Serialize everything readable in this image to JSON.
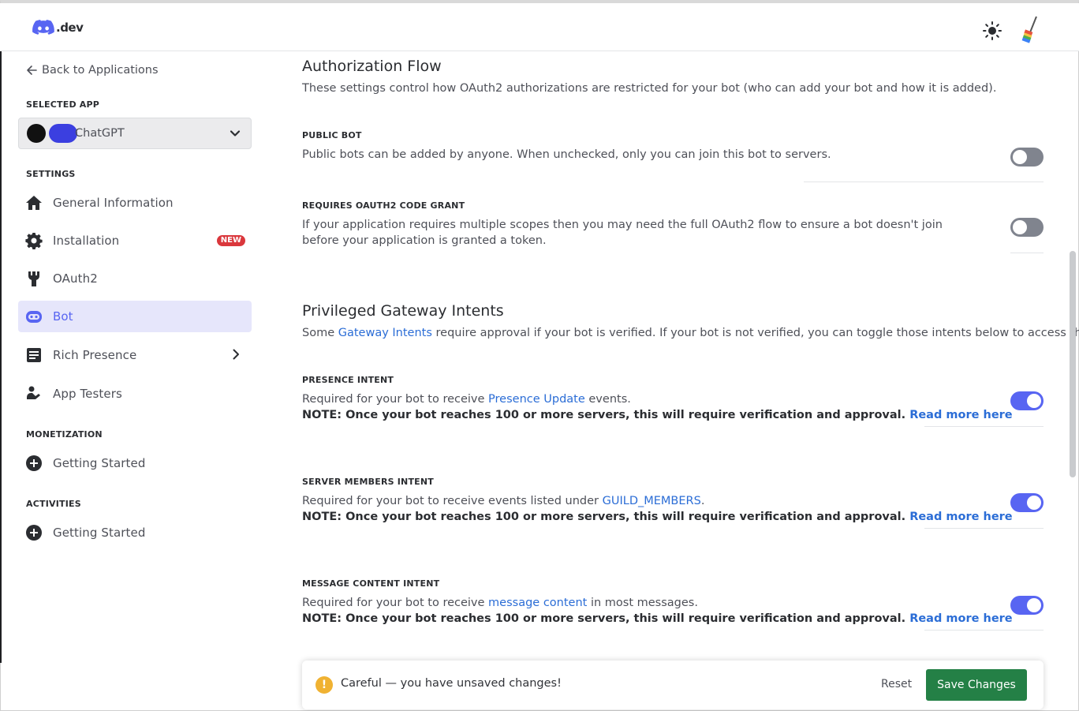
{
  "header": {
    "logo_text": ".dev",
    "theme_icon": "sun-icon",
    "user_icon": "avatar-icon"
  },
  "sidebar": {
    "back_label": "Back to Applications",
    "selected_app_label": "SELECTED APP",
    "app_name": "ChatGPT",
    "settings_label": "SETTINGS",
    "items": [
      {
        "label": "General Information",
        "icon": "home-icon"
      },
      {
        "label": "Installation",
        "icon": "gear-icon",
        "badge": "NEW"
      },
      {
        "label": "OAuth2",
        "icon": "wrench-icon"
      },
      {
        "label": "Bot",
        "icon": "robot-icon",
        "active": true
      },
      {
        "label": "Rich Presence",
        "icon": "document-icon"
      },
      {
        "label": "App Testers",
        "icon": "user-icon"
      }
    ],
    "monetization_label": "MONETIZATION",
    "monetization_item": "Getting Started",
    "activities_label": "ACTIVITIES",
    "activities_item": "Getting Started"
  },
  "main": {
    "auth_title": "Authorization Flow",
    "auth_desc": "These settings control how OAuth2 authorizations are restricted for your bot (who can add your bot and how it is added).",
    "public_bot": {
      "label": "PUBLIC BOT",
      "desc": "Public bots can be added by anyone. When unchecked, only you can join this bot to servers.",
      "enabled": false
    },
    "code_grant": {
      "label": "REQUIRES OAUTH2 CODE GRANT",
      "desc": "If your application requires multiple scopes then you may need the full OAuth2 flow to ensure a bot doesn't join before your application is granted a token.",
      "enabled": false
    },
    "intents_title": "Privileged Gateway Intents",
    "intents_desc_pre": "Some ",
    "intents_desc_link": "Gateway Intents",
    "intents_desc_post": " require approval if your bot is verified. If your bot is not verified, you can toggle those intents below to access them.",
    "note_text": "NOTE: Once your bot reaches 100 or more servers, this will require verification and approval. ",
    "read_more": "Read more here",
    "presence": {
      "label": "PRESENCE INTENT",
      "pre": "Required for your bot to receive ",
      "link": "Presence Update",
      "post": " events.",
      "enabled": true
    },
    "members": {
      "label": "SERVER MEMBERS INTENT",
      "pre": "Required for your bot to receive events listed under ",
      "link": "GUILD_MEMBERS",
      "post": ".",
      "enabled": true
    },
    "message": {
      "label": "MESSAGE CONTENT INTENT",
      "pre": "Required for your bot to receive ",
      "link": "message content",
      "post": " in most messages.",
      "enabled": true
    }
  },
  "toast": {
    "icon": "warning-icon",
    "text": "Careful — you have unsaved changes!",
    "reset_label": "Reset",
    "save_label": "Save Changes"
  },
  "colors": {
    "accent": "#5865f2",
    "link": "#2b6dd6",
    "save": "#248046",
    "badge": "#da373c",
    "warning": "#f0b232"
  }
}
